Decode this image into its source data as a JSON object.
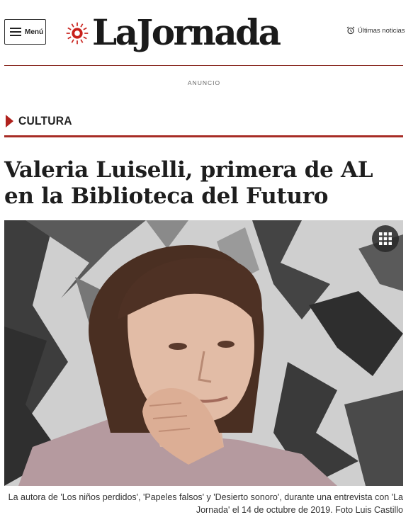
{
  "header": {
    "menu_label": "Menú",
    "logo_text": "LaJornada",
    "latest_label": "Últimas noticias",
    "menu_icon": "hamburger-icon",
    "latest_icon": "alarm-clock-icon",
    "logo_icon": "la-jornada-sun-logo"
  },
  "ad": {
    "label": "ANUNCIO"
  },
  "section": {
    "label": "CULTURA",
    "icon": "triangle-right-icon",
    "accent": "#b0211d"
  },
  "article": {
    "headline": "Valeria Luiselli, primera de AL en la Biblioteca del Futuro",
    "gallery_icon": "grid-gallery-icon",
    "caption": "La autora de 'Los niños perdidos', 'Papeles falsos' y 'Desierto sonoro', durante una entrevista con 'La Jornada' el 14 de octubre de 2019. Foto Luis Castillo"
  },
  "colors": {
    "rule": "#8a2b23",
    "section_rule": "#a72c25",
    "text": "#1e1e1e"
  }
}
